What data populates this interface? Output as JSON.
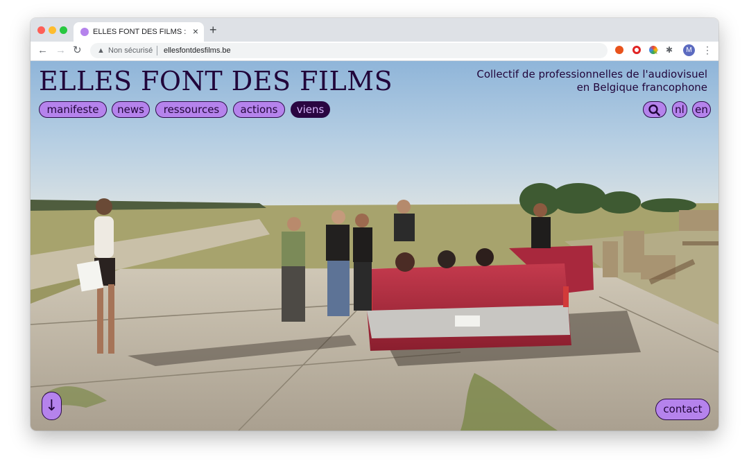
{
  "browser": {
    "tab_title": "ELLES FONT DES FILMS : Collectif de professionnelles de l'audiovisuel en Belgique francophone",
    "tab_close_icon": "close-icon",
    "new_tab_icon": "plus-icon",
    "nav_icons": [
      "back-arrow-icon",
      "forward-arrow-icon",
      "reload-icon"
    ],
    "security_label": "Non sécurisé",
    "url": "ellesfontdesfilms.be",
    "toolbar_icons": [
      "star-icon",
      "extension-fire-icon",
      "extension-opera-icon",
      "extension-color-icon",
      "puzzle-icon",
      "menu-dots-icon"
    ],
    "profile_initial": "M"
  },
  "site": {
    "title": "ELLES FONT DES FILMS",
    "tagline_line1": "Collectif de professionnelles de l'audiovisuel",
    "tagline_line2": "en Belgique francophone",
    "nav": [
      {
        "label": "manifeste"
      },
      {
        "label": "news"
      },
      {
        "label": "ressources"
      },
      {
        "label": "actions"
      },
      {
        "label": "viens",
        "active": true
      }
    ],
    "search_icon": "search-icon",
    "lang": [
      "nl",
      "en"
    ],
    "scroll_down_icon": "arrow-down-icon",
    "contact_label": "contact"
  },
  "colors": {
    "accent": "#b583ec",
    "ink": "#21053a",
    "active_bg": "#2a0641"
  }
}
